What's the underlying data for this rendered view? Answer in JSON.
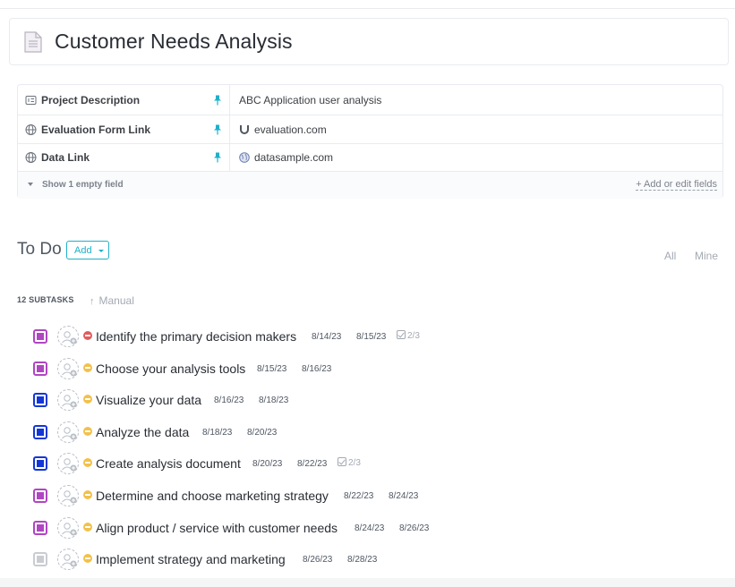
{
  "document": {
    "title": "Customer Needs Analysis",
    "icon": "document-icon"
  },
  "fields": {
    "rows": [
      {
        "name": "Project Description",
        "icon": "text-field-icon",
        "value": "ABC Application user analysis",
        "value_icon": ""
      },
      {
        "name": "Evaluation Form Link",
        "icon": "globe-icon",
        "value": "evaluation.com",
        "value_icon": "magnet-icon"
      },
      {
        "name": "Data Link",
        "icon": "globe-icon",
        "value": "datasample.com",
        "value_icon": "world-icon"
      }
    ],
    "show_empty": "Show 1 empty field",
    "add_edit": "+ Add or edit fields"
  },
  "todo": {
    "title": "To Do",
    "add_label": "Add",
    "filter_all": "All",
    "filter_mine": "Mine",
    "subtasks_count": "12 SUBTASKS",
    "sort_label": "Manual"
  },
  "colors": {
    "purple": "#b046c2",
    "blue": "#1237d6",
    "gray": "#c9ccd1",
    "priority_high": "#e05c5c",
    "priority_normal": "#f2c14b",
    "accent": "#1fb0c9"
  },
  "tasks": [
    {
      "name": "Identify the primary decision makers",
      "start": "8/14/23",
      "due": "8/15/23",
      "checklist": "2/3",
      "status_color": "#b046c2",
      "priority_color": "#e05c5c"
    },
    {
      "name": "Choose your analysis tools",
      "start": "8/15/23",
      "due": "8/16/23",
      "checklist": "",
      "status_color": "#b046c2",
      "priority_color": "#f2c14b"
    },
    {
      "name": "Visualize your data",
      "start": "8/16/23",
      "due": "8/18/23",
      "checklist": "",
      "status_color": "#1237d6",
      "priority_color": "#f2c14b"
    },
    {
      "name": "Analyze the data",
      "start": "8/18/23",
      "due": "8/20/23",
      "checklist": "",
      "status_color": "#1237d6",
      "priority_color": "#f2c14b"
    },
    {
      "name": "Create analysis document",
      "start": "8/20/23",
      "due": "8/22/23",
      "checklist": "2/3",
      "status_color": "#1237d6",
      "priority_color": "#f2c14b"
    },
    {
      "name": "Determine and choose marketing strategy",
      "start": "8/22/23",
      "due": "8/24/23",
      "checklist": "",
      "status_color": "#b046c2",
      "priority_color": "#f2c14b"
    },
    {
      "name": "Align product / service with customer needs",
      "start": "8/24/23",
      "due": "8/26/23",
      "checklist": "",
      "status_color": "#b046c2",
      "priority_color": "#f2c14b"
    },
    {
      "name": "Implement strategy and marketing",
      "start": "8/26/23",
      "due": "8/28/23",
      "checklist": "",
      "status_color": "#c9ccd1",
      "priority_color": "#f2c14b"
    }
  ]
}
